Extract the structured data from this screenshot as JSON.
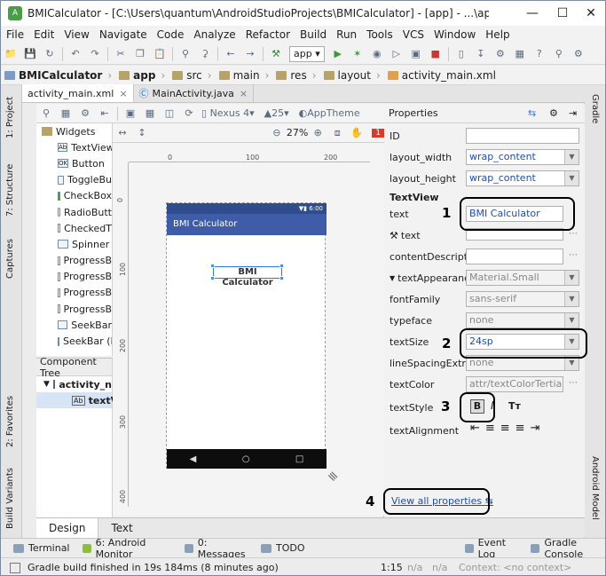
{
  "window": {
    "title": "BMICalculator - [C:\\Users\\quantum\\AndroidStudioProjects\\BMICalculator] - [app] - ...\\app\\src\\main\\res\\layout\\a..."
  },
  "menu": [
    "File",
    "Edit",
    "View",
    "Navigate",
    "Code",
    "Analyze",
    "Refactor",
    "Build",
    "Run",
    "Tools",
    "VCS",
    "Window",
    "Help"
  ],
  "toolbar": {
    "run_config": "app"
  },
  "breadcrumbs": [
    "BMICalculator",
    "app",
    "src",
    "main",
    "res",
    "layout",
    "activity_main.xml"
  ],
  "tabs": [
    {
      "label": "activity_main.xml"
    },
    {
      "label": "MainActivity.java"
    }
  ],
  "left_strip": {
    "project": "1: Project",
    "structure": "7: Structure",
    "captures": "Captures",
    "favorites": "2: Favorites",
    "build_variants": "Build Variants"
  },
  "right_strip": {
    "gradle": "Gradle",
    "android_model": "Android Model"
  },
  "layout_toolbar": {
    "device": "Nexus 4",
    "api": "25",
    "theme": "AppTheme",
    "zoom": "27%",
    "error_count": "1"
  },
  "palette": {
    "header": "Widgets",
    "items": [
      "TextView",
      "Button",
      "ToggleBu",
      "CheckBox",
      "RadioButt",
      "CheckedT",
      "Spinner",
      "ProgressB",
      "ProgressB",
      "ProgressB",
      "ProgressB",
      "SeekBar",
      "SeekBar (D"
    ],
    "icons": [
      "Ab",
      "OK",
      "",
      "",
      "",
      "",
      "",
      "",
      "",
      "",
      "",
      "",
      ""
    ]
  },
  "component_tree": {
    "header": "Component Tree",
    "root": "activity_n",
    "child": "textV",
    "child_icon": "Ab"
  },
  "ruler": {
    "h": [
      "0",
      "100",
      "200"
    ],
    "v": [
      "0",
      "100",
      "200",
      "300",
      "400"
    ]
  },
  "device": {
    "time": "6:00",
    "app_title": "BMI Calculator",
    "selected_text": "BMI Calculator"
  },
  "properties": {
    "header": "Properties",
    "id_label": "ID",
    "layout_width_label": "layout_width",
    "layout_width": "wrap_content",
    "layout_height_label": "layout_height",
    "layout_height": "wrap_content",
    "section": "TextView",
    "text_label": "text",
    "text": "BMI Calculator",
    "tools_text_label": "text",
    "content_desc_label": "contentDescripti...",
    "text_appearance_label": "textAppearance",
    "text_appearance": "Material.Small",
    "font_family_label": "fontFamily",
    "font_family": "sans-serif",
    "typeface_label": "typeface",
    "typeface": "none",
    "text_size_label": "textSize",
    "text_size": "24sp",
    "line_spacing_label": "lineSpacingExtra",
    "line_spacing": "none",
    "text_color_label": "textColor",
    "text_color": "attr/textColorTertiary",
    "text_style_label": "textStyle",
    "text_alignment_label": "textAlignment",
    "view_all": "View all properties"
  },
  "callouts": [
    "1",
    "2",
    "3",
    "4"
  ],
  "design_tabs": [
    "Design",
    "Text"
  ],
  "bottom_tools": [
    "Terminal",
    "6: Android Monitor",
    "0: Messages",
    "TODO",
    "Event Log",
    "Gradle Console"
  ],
  "status": {
    "message": "Gradle build finished in 19s 184ms (8 minutes ago)",
    "pos": "1:15",
    "na1": "n/a",
    "na2": "n/a",
    "context": "Context: <no context>"
  }
}
